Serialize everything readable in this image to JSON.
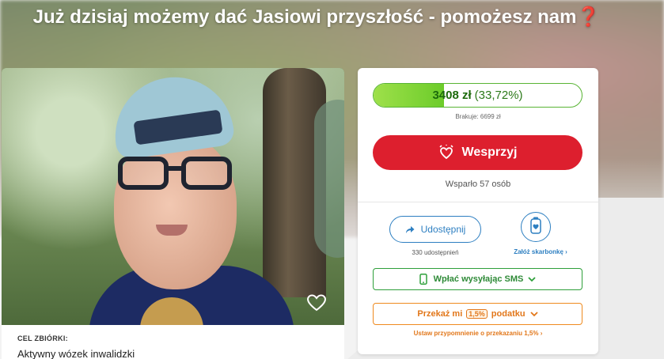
{
  "page": {
    "title_text": "Już dzisiaj możemy dać Jasiowi przyszłość - pomożesz nam",
    "title_emoji": "❓"
  },
  "photo": {
    "favorite_icon": "heart-outline-icon"
  },
  "goal": {
    "label": "CEL ZBIÓRKI:",
    "value": "Aktywny wózek inwalidzki"
  },
  "donation": {
    "amount": "3408 zł",
    "percent_text": "(33,72%)",
    "progress_fraction": 0.3372,
    "missing_text": "Brakuje: 6699 zł",
    "donate_label": "Wesprzyj",
    "supporters_text": "Wsparło 57 osób"
  },
  "share": {
    "share_label": "Udostępnij",
    "share_count_text": "330 udostępnień",
    "piggy_label": "Załóż skarbonkę",
    "piggy_chevron": "›"
  },
  "sms": {
    "label": "Wpłać wysyłając SMS"
  },
  "tax": {
    "label_before": "Przekaż mi",
    "percent": "1,5%",
    "label_after": "podatku",
    "reminder_text": "Ustaw przypomnienie o przekazaniu 1,5%",
    "reminder_chevron": "›"
  },
  "colors": {
    "brand_red": "#dd1f2e",
    "progress_green": "#6ccc2a",
    "share_blue": "#2d7fc1",
    "sms_green": "#2e9f3a",
    "tax_orange": "#ef8a1f"
  }
}
